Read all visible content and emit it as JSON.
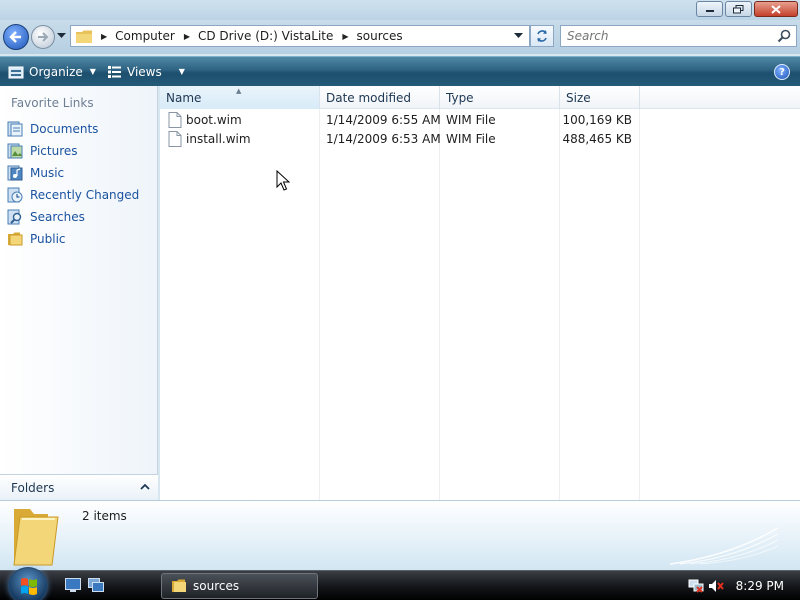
{
  "address": {
    "crumbs": [
      "Computer",
      "CD Drive (D:) VistaLite",
      "sources"
    ]
  },
  "search": {
    "placeholder": "Search"
  },
  "toolbar": {
    "organize_label": "Organize",
    "views_label": "Views"
  },
  "navpane": {
    "heading": "Favorite Links",
    "links": [
      {
        "label": "Documents",
        "icon": "documents-icon"
      },
      {
        "label": "Pictures",
        "icon": "pictures-icon"
      },
      {
        "label": "Music",
        "icon": "music-icon"
      },
      {
        "label": "Recently Changed",
        "icon": "recently-changed-icon"
      },
      {
        "label": "Searches",
        "icon": "searches-icon"
      },
      {
        "label": "Public",
        "icon": "folder-icon"
      }
    ],
    "folders_label": "Folders"
  },
  "columns": {
    "name": "Name",
    "date": "Date modified",
    "type": "Type",
    "size": "Size"
  },
  "files": [
    {
      "name": "boot.wim",
      "date": "1/14/2009 6:55 AM",
      "type": "WIM File",
      "size": "100,169 KB"
    },
    {
      "name": "install.wim",
      "date": "1/14/2009 6:53 AM",
      "type": "WIM File",
      "size": "488,465 KB"
    }
  ],
  "details": {
    "item_count": "2 items"
  },
  "taskbar": {
    "window_label": "sources",
    "clock": "8:29 PM"
  },
  "colors": {
    "toolbar": "#2e6282",
    "link": "#1b53a0",
    "close": "#c3402b"
  }
}
